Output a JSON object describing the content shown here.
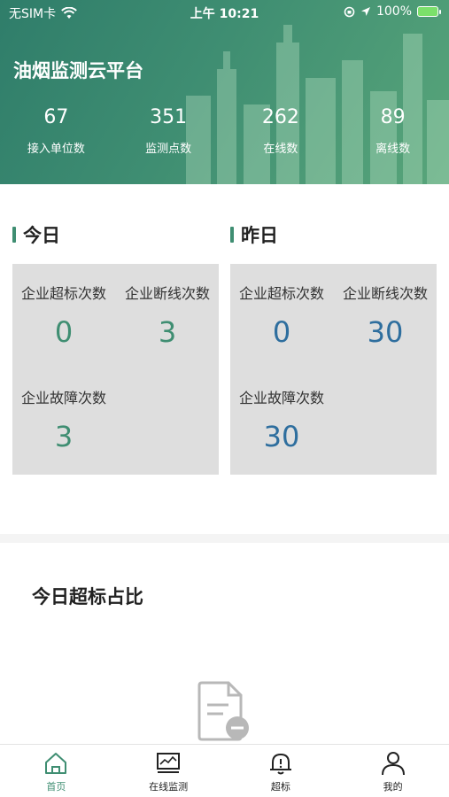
{
  "status_bar": {
    "carrier": "无SIM卡",
    "time": "上午 10:21",
    "battery": "100%"
  },
  "header": {
    "title": "油烟监测云平台",
    "stats": [
      {
        "value": "67",
        "label": "接入单位数"
      },
      {
        "value": "351",
        "label": "监测点数"
      },
      {
        "value": "262",
        "label": "在线数"
      },
      {
        "value": "89",
        "label": "离线数"
      }
    ]
  },
  "today": {
    "title": "今日",
    "over_label": "企业超标次数",
    "over_value": "0",
    "offline_label": "企业断线次数",
    "offline_value": "3",
    "fault_label": "企业故障次数",
    "fault_value": "3"
  },
  "yesterday": {
    "title": "昨日",
    "over_label": "企业超标次数",
    "over_value": "0",
    "offline_label": "企业断线次数",
    "offline_value": "30",
    "fault_label": "企业故障次数",
    "fault_value": "30"
  },
  "chart": {
    "title": "今日超标占比",
    "empty_icon": "no-data-document-icon"
  },
  "tabs": [
    {
      "label": "首页",
      "icon": "home-icon",
      "active": true
    },
    {
      "label": "在线监测",
      "icon": "monitor-icon",
      "active": false
    },
    {
      "label": "超标",
      "icon": "bell-alert-icon",
      "active": false
    },
    {
      "label": "我的",
      "icon": "user-icon",
      "active": false
    }
  ],
  "colors": {
    "accent": "#3f8e72",
    "today_value": "#3f8e72",
    "yesterday_value": "#2e6e9e",
    "panel_bg": "#dedede"
  }
}
